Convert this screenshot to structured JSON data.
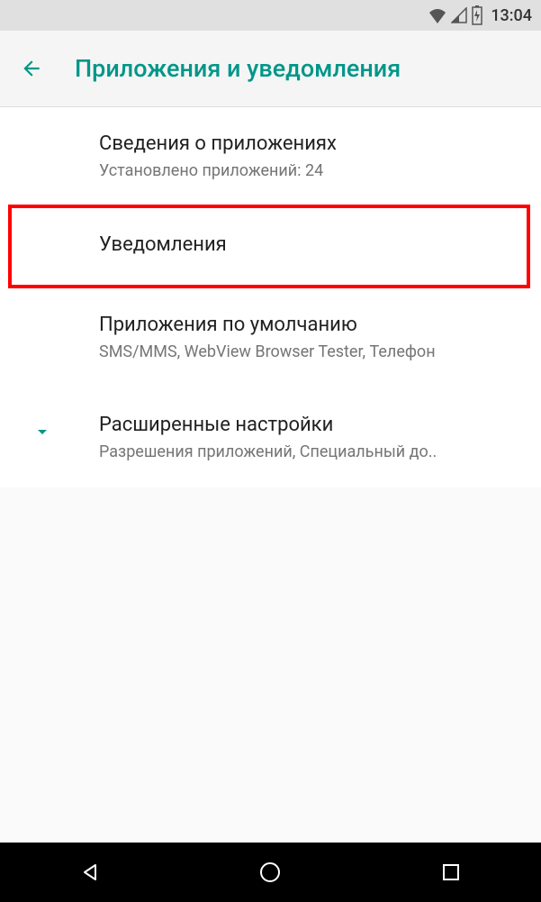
{
  "status": {
    "time": "13:04"
  },
  "header": {
    "title": "Приложения и уведомления"
  },
  "items": [
    {
      "title": "Сведения о приложениях",
      "subtitle": "Установлено приложений: 24"
    },
    {
      "title": "Уведомления",
      "subtitle": ""
    },
    {
      "title": "Приложения по умолчанию",
      "subtitle": "SMS/MMS, WebView Browser Tester, Телефон"
    },
    {
      "title": "Расширенные настройки",
      "subtitle": "Разрешения приложений, Специальный до.."
    }
  ]
}
